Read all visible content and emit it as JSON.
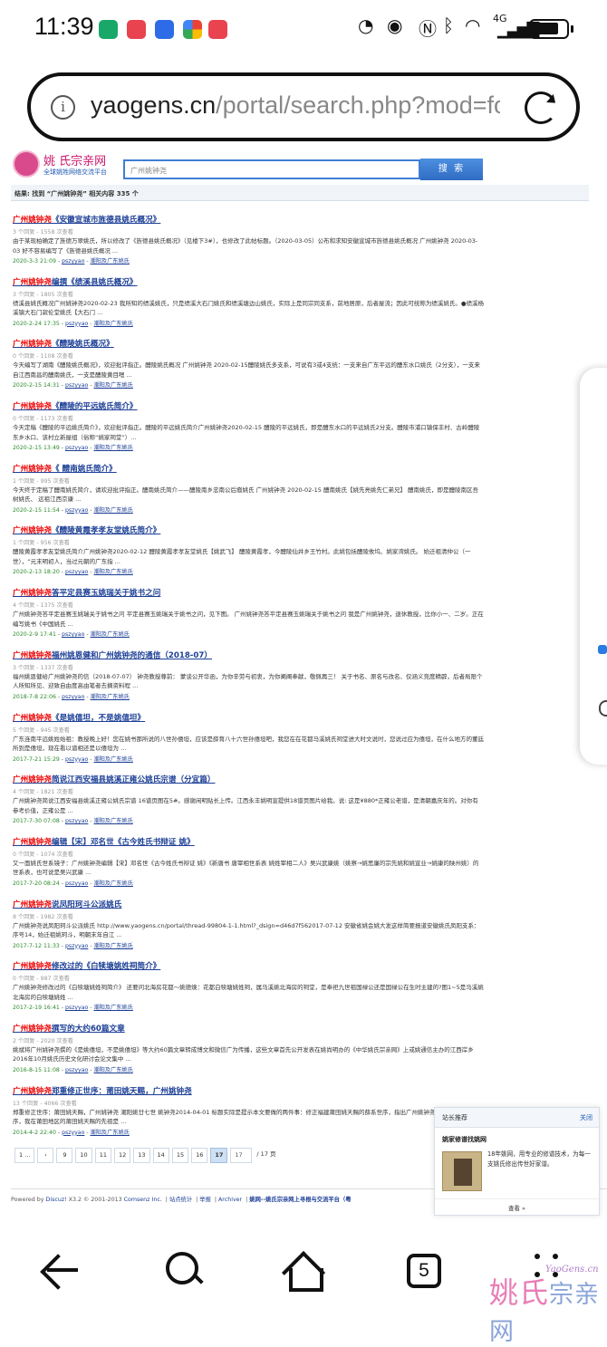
{
  "status": {
    "time": "11:39",
    "network": "4G"
  },
  "browser": {
    "url_domain": "yaogens.cn",
    "url_path": "/portal/search.php?mod=forum",
    "tab_count": "5"
  },
  "site": {
    "logo_name": "姚 氏宗亲网",
    "logo_tagline": "全球姚姓网络交流平台",
    "search_value": "广州姚钟尧",
    "search_button": "搜 索",
    "result_summary": "结果: 找到 “广州姚钟尧” 相关内容 335 个"
  },
  "results": [
    {
      "title": "《安徽宣城市旌德县姚氏概况》",
      "meta": "3 个回复 - 1558 次查看",
      "desc": "由于某现柏确定了旌德万翠姚氏，所以修改了《旌德县姚氏概况》（见楼下3#），也修改了此帖标题。（2020-03-05）公布和求知安徽宣城市旌德县姚氏概况 广州姚钟尧 2020-03-03 好不容易编写了《旌德县姚氏概况 ...",
      "date": "2020-3-3 21:09",
      "author": "pszyyao",
      "forum": "潮阳及广东姚氏"
    },
    {
      "title": "编撰《绩溪县姚氏概况》",
      "meta": "3 个回复 - 1805 次查看",
      "desc": "绩溪县姚氏概况广州姚钟尧2020-02-23 我所知的绩溪姚氏，只是绩溪大石门姚氏和绩溪塘边山姚氏，实际上是同宗同支系，前地居原，后者屋流；因此可统称为绩溪姚氏。●绩溪杨溪镇大石门寂伦堂姚氏【大石门 ...",
      "date": "2020-2-24 17:35",
      "author": "pszyyao",
      "forum": "潮阳及广东姚氏"
    },
    {
      "title": "《醴陵姚氏概况》",
      "meta": "0 个回复 - 1108 次查看",
      "desc": "今天编写了湖南《醴陵姚氏概况》，欢迎批评指正。醴陵姚氏概况 广州姚钟尧 2020-02-15醴陵姚氏多支系，可说有3或4支统：一支来自广东平远的醴东水口姚氏（2分支），一支来自江西南昌的醴南姚氏，一支是醴陵黄目嗯 ...",
      "date": "2020-2-15 14:31",
      "author": "pszyyao",
      "forum": "潮阳及广东姚氏"
    },
    {
      "title": "《醴陵的平远姚氏简介》",
      "meta": "0 个回复 - 1173 次查看",
      "desc": "今天定稿《醴陵的平远姚氏简介》，欢迎批评指正。醴陵的平远姚氏简介广州姚钟尧2020-02-15 醴陵的平远姚氏，即是醴东水口的平远姚氏2分支。醴陵市浦口镇保丰村、古岭醴陵东乡水口、该村立新屋组（俗称“姚家祠堂”）...",
      "date": "2020-2-15 13:49",
      "author": "pszyyao",
      "forum": "潮阳及广东姚氏"
    },
    {
      "title": "《 醴南姚氏简介》",
      "meta": "1 个回复 - 995 次查看",
      "desc": "今天终于定稿了醴南姚氏简介，请欢迎批评指正。醴南姚氏简介——醴陵南乡忠南公后裔姚氏 广州姚钟尧 2020-02-15 醴南姚氏【姚先亮姚先仁弟兄】 醴南姚氏，即是醴陵南区吾树姚氏、 远祖江西京康 ...",
      "date": "2020-2-15 11:54",
      "author": "pszyyao",
      "forum": "潮阳及广东姚氏"
    },
    {
      "title": "《醴陵黄霞孝孝友堂姚氏简介》",
      "meta": "1 个回复 - 956 次查看",
      "desc": "醴陵黄霞孝孝友堂姚氏简介广州姚钟尧2020-02-12 醴陵黄霞孝孝友堂姚氏【姚武飞】 醴陵黄霞孝，今醴陵仙井乡王竹村。此姚包括醴陵攸坞、姚家湾姚氏。 始迁祖清仲公（一世），“元末明初人，当过元朝的广东指 ...",
      "date": "2020-2-13 18:20",
      "author": "pszyyao",
      "forum": "潮阳及广东姚氏"
    },
    {
      "title": "答平定县赛玉姚瑞关于姚书之问",
      "meta": "4 个回复 - 1375 次查看",
      "desc": "广州姚钟尧答平定县赛玉姚瑞关于姚书之问 平定县赛玉姚瑞关于姚书之问，见下图。 广州姚钟尧答平定县赛玉姚瑞关于姚书之问 我是广州姚钟尧，退休教授，比你小一、二岁。正在编写姚书《中国姚氏 ...",
      "date": "2020-2-9 17:41",
      "author": "pszyyao",
      "forum": "潮阳及广东姚氏"
    },
    {
      "title": "福州姚恩健和广州姚钟尧的通信（2018-07）",
      "meta": "3 个回复 - 1337 次查看",
      "desc": "福州姚恩健给广州姚钟尧的信（2018-07-07） 钟尧教授尊前： 蒙谈公开华函，为你辛劳与初衷，为你阐阐奉献，敬佩再三！ 关于书名、原名与改名、仅涵义竞度精辟，后者局限个人所知所见、迎致自由度高由笔者去摘资料程 ...",
      "date": "2018-7-8 22:06",
      "author": "pszyyao",
      "forum": "潮阳及广东姚氏"
    },
    {
      "title": "《是姚僖坦，不是姚僖坦》",
      "meta": "5 个回复 - 945 次查看",
      "desc": "广东连南平远姚姓始祖：教授晚上好！您在姚书那所说的八世孙僖坦，应该是薛育八十六世孙僖坦吧，我您在在花都马溪姚氏祠堂进大时文说时，您说过应为僖坦，在什么地方的董廷所到是僖坦，现在看以谱相还是以僖坦为 ...",
      "date": "2017-7-21 15:29",
      "author": "pszyyao",
      "forum": "潮阳及广东姚氏"
    },
    {
      "title": "简说江西安福县姚溪正雍公姚氏宗谱（分宜篇）",
      "meta": "4 个回复 - 1821 次查看",
      "desc": "广州姚钟尧简说江西安福县姚溪正雍公姚氏宗谱 16谱页图在5#。感谢闲明贴长上传。江西永丰姚明宣提供18谱页图片给我。说: 这是¥880*正雍公老谱，是清朝嘉庆年的。对你有参考价值，正雍公是 ...",
      "date": "2017-7-30 07:08",
      "author": "pszyyao",
      "forum": "潮阳及广东姚氏"
    },
    {
      "title": "编辑【宋】邓名世《古今姓氏书辩证 姚》",
      "meta": "0 个回复 - 1074 次查看",
      "desc": "又一面姚氏世系镜子：广州姚钟尧编辑【宋】邓名世《古今姓氏书辩证 姚》《新唐书 唐宰相世系表 姚姓宰相二人》吴兴武康姚（姚察→姚思廉的宗先姚和姚宣业→姚康的陕州姚）的世系表，也可说是吴兴武康 ...",
      "date": "2017-7-20 08:24",
      "author": "pszyyao",
      "forum": "潮阳及广东姚氏"
    },
    {
      "title": "说凤阳珂斗公派姚氏",
      "meta": "8 个回复 - 1982 次查看",
      "desc": "广州姚钟尧说凤阳珂斗公派姚氏 http://www.yaogens.cn/portal/thread-99804-1-1.html?_dsign=d46d7f562017-07-12 安徽省姚会姚大发这样简要报道安徽姚氏凤阳支系：序号14，始迁祖姚珂斗，明朝末年自江 ...",
      "date": "2017-7-12 11:33",
      "author": "pszyyao",
      "forum": "潮阳及广东姚氏"
    },
    {
      "title": "修改过的《白犊塘姚姓祠简介》",
      "meta": "0 个回复 - 987 次查看",
      "desc": "广州姚钟尧修改过的《白犊塘姚姓祠简介》 还要问北海房花都～姚德焕：花都白犊塘姚姓祠，属马溪姚北海房的祠堂，是奉祀九世祖国禄公还是国禄公在生时主建的?图1~5是马溪姚北海房的白犊塘姚姓 ...",
      "date": "2017-2-19 16:41",
      "author": "pszyyao",
      "forum": "潮阳及广东姚氏"
    },
    {
      "title": "撰写的大约60篇文章",
      "meta": "2 个回复 - 2020 次查看",
      "desc": "姚斌将广州姚钟尧撰的《是姚僖坦，不是姚僖坦》等大约60篇文章转成博文和微信广为传播，这些文章首先公开发表在姚尚明办的《中华姚氏宗亲网》上或姚通信主办的江西岸乡2016年10月姚氏历史文化研讨会论文集中 ...",
      "date": "2016-8-15 11:08",
      "author": "pszyyao",
      "forum": "潮阳及广东姚氏"
    },
    {
      "title": "郑重修正世序：莆田姚天赐，广州姚钟尧",
      "meta": "13 个回复 - 4066 次查看",
      "desc": "郑重修正世序：莆田姚天赐，广州姚钟尧 潮阳姚廿七世 姚钟尧2014-04-01 标题实际是提示本文要做的两件事：修正福建莆田姚天赐的薛系世序，指出广州姚钟尧在姚廿七世的世序，我在莆田地区的莆田姚天赐的先祖是 ...",
      "date": "2014-4-2 22:40",
      "author": "pszyyao",
      "forum": "潮阳及广东姚氏"
    }
  ],
  "hl": "广州姚钟尧",
  "pager": {
    "first": "1 ...",
    "prev": "‹",
    "pages": [
      "9",
      "10",
      "11",
      "12",
      "13",
      "14",
      "15",
      "16",
      "17"
    ],
    "current": "17",
    "input": "17",
    "total": "/ 17 页"
  },
  "footer": {
    "powered": "Powered by ",
    "discuz": "Discuz!",
    "version": " X3.2 © 2001-2013 ",
    "comsenz": "Comsenz Inc.",
    "links": [
      "站点统计",
      "举报",
      "Archiver"
    ],
    "site_name": "姚网--姚氏宗亲网上寻根与交流平台（粤"
  },
  "popup": {
    "header": "站长推荐",
    "close": "关闭",
    "title": "姚家修谱找姚网",
    "desc": "18年姚网，用专业的修谱技术，为每一支姚氏修出传世好家谱。",
    "more": "查看 »"
  },
  "watermark": {
    "main": "姚氏",
    "sub": "宗亲网",
    "url": "YaoGens.cn"
  }
}
